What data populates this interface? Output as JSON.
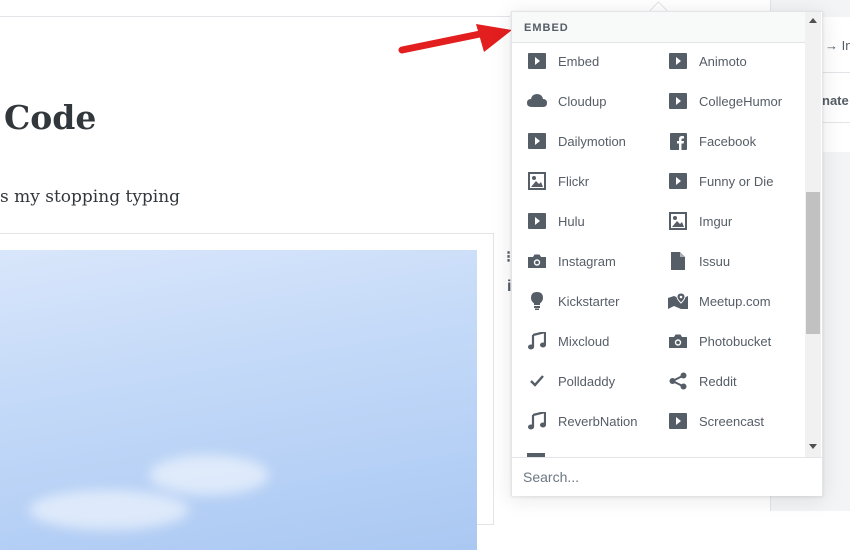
{
  "editor": {
    "title": "Code",
    "paragraph": "s my stopping typing"
  },
  "sidebar": {
    "arrow_label": "→ In",
    "partial_label": "nate"
  },
  "embed_menu": {
    "header": "EMBED",
    "items": [
      {
        "label": "Embed",
        "icon": "play-icon"
      },
      {
        "label": "Animoto",
        "icon": "play-icon"
      },
      {
        "label": "Cloudup",
        "icon": "cloud-icon"
      },
      {
        "label": "CollegeHumor",
        "icon": "play-icon"
      },
      {
        "label": "Dailymotion",
        "icon": "play-icon"
      },
      {
        "label": "Facebook",
        "icon": "facebook-icon"
      },
      {
        "label": "Flickr",
        "icon": "image-icon"
      },
      {
        "label": "Funny or Die",
        "icon": "play-icon"
      },
      {
        "label": "Hulu",
        "icon": "play-icon"
      },
      {
        "label": "Imgur",
        "icon": "image-icon"
      },
      {
        "label": "Instagram",
        "icon": "camera-icon"
      },
      {
        "label": "Issuu",
        "icon": "document-icon"
      },
      {
        "label": "Kickstarter",
        "icon": "lightbulb-icon"
      },
      {
        "label": "Meetup.com",
        "icon": "map-icon"
      },
      {
        "label": "Mixcloud",
        "icon": "music-icon"
      },
      {
        "label": "Photobucket",
        "icon": "camera-icon"
      },
      {
        "label": "Polldaddy",
        "icon": "check-icon"
      },
      {
        "label": "Reddit",
        "icon": "share-icon"
      },
      {
        "label": "ReverbNation",
        "icon": "music-icon"
      },
      {
        "label": "Screencast",
        "icon": "play-icon"
      }
    ],
    "search_placeholder": "Search..."
  },
  "colors": {
    "annotation_arrow": "#e31e1e",
    "icon": "#555d66"
  }
}
